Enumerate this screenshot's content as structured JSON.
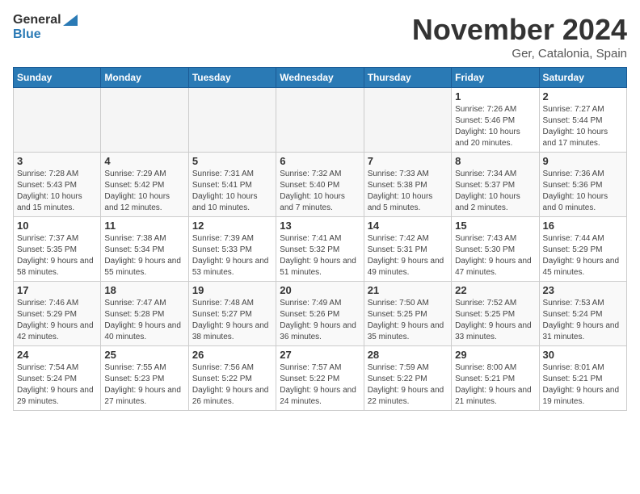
{
  "logo": {
    "line1": "General",
    "line2": "Blue"
  },
  "title": "November 2024",
  "location": "Ger, Catalonia, Spain",
  "days_of_week": [
    "Sunday",
    "Monday",
    "Tuesday",
    "Wednesday",
    "Thursday",
    "Friday",
    "Saturday"
  ],
  "weeks": [
    [
      {
        "day": "",
        "empty": true
      },
      {
        "day": "",
        "empty": true
      },
      {
        "day": "",
        "empty": true
      },
      {
        "day": "",
        "empty": true
      },
      {
        "day": "",
        "empty": true
      },
      {
        "day": "1",
        "sunrise": "7:26 AM",
        "sunset": "5:46 PM",
        "daylight": "10 hours and 20 minutes."
      },
      {
        "day": "2",
        "sunrise": "7:27 AM",
        "sunset": "5:44 PM",
        "daylight": "10 hours and 17 minutes."
      }
    ],
    [
      {
        "day": "3",
        "sunrise": "7:28 AM",
        "sunset": "5:43 PM",
        "daylight": "10 hours and 15 minutes."
      },
      {
        "day": "4",
        "sunrise": "7:29 AM",
        "sunset": "5:42 PM",
        "daylight": "10 hours and 12 minutes."
      },
      {
        "day": "5",
        "sunrise": "7:31 AM",
        "sunset": "5:41 PM",
        "daylight": "10 hours and 10 minutes."
      },
      {
        "day": "6",
        "sunrise": "7:32 AM",
        "sunset": "5:40 PM",
        "daylight": "10 hours and 7 minutes."
      },
      {
        "day": "7",
        "sunrise": "7:33 AM",
        "sunset": "5:38 PM",
        "daylight": "10 hours and 5 minutes."
      },
      {
        "day": "8",
        "sunrise": "7:34 AM",
        "sunset": "5:37 PM",
        "daylight": "10 hours and 2 minutes."
      },
      {
        "day": "9",
        "sunrise": "7:36 AM",
        "sunset": "5:36 PM",
        "daylight": "10 hours and 0 minutes."
      }
    ],
    [
      {
        "day": "10",
        "sunrise": "7:37 AM",
        "sunset": "5:35 PM",
        "daylight": "9 hours and 58 minutes."
      },
      {
        "day": "11",
        "sunrise": "7:38 AM",
        "sunset": "5:34 PM",
        "daylight": "9 hours and 55 minutes."
      },
      {
        "day": "12",
        "sunrise": "7:39 AM",
        "sunset": "5:33 PM",
        "daylight": "9 hours and 53 minutes."
      },
      {
        "day": "13",
        "sunrise": "7:41 AM",
        "sunset": "5:32 PM",
        "daylight": "9 hours and 51 minutes."
      },
      {
        "day": "14",
        "sunrise": "7:42 AM",
        "sunset": "5:31 PM",
        "daylight": "9 hours and 49 minutes."
      },
      {
        "day": "15",
        "sunrise": "7:43 AM",
        "sunset": "5:30 PM",
        "daylight": "9 hours and 47 minutes."
      },
      {
        "day": "16",
        "sunrise": "7:44 AM",
        "sunset": "5:29 PM",
        "daylight": "9 hours and 45 minutes."
      }
    ],
    [
      {
        "day": "17",
        "sunrise": "7:46 AM",
        "sunset": "5:29 PM",
        "daylight": "9 hours and 42 minutes."
      },
      {
        "day": "18",
        "sunrise": "7:47 AM",
        "sunset": "5:28 PM",
        "daylight": "9 hours and 40 minutes."
      },
      {
        "day": "19",
        "sunrise": "7:48 AM",
        "sunset": "5:27 PM",
        "daylight": "9 hours and 38 minutes."
      },
      {
        "day": "20",
        "sunrise": "7:49 AM",
        "sunset": "5:26 PM",
        "daylight": "9 hours and 36 minutes."
      },
      {
        "day": "21",
        "sunrise": "7:50 AM",
        "sunset": "5:25 PM",
        "daylight": "9 hours and 35 minutes."
      },
      {
        "day": "22",
        "sunrise": "7:52 AM",
        "sunset": "5:25 PM",
        "daylight": "9 hours and 33 minutes."
      },
      {
        "day": "23",
        "sunrise": "7:53 AM",
        "sunset": "5:24 PM",
        "daylight": "9 hours and 31 minutes."
      }
    ],
    [
      {
        "day": "24",
        "sunrise": "7:54 AM",
        "sunset": "5:24 PM",
        "daylight": "9 hours and 29 minutes."
      },
      {
        "day": "25",
        "sunrise": "7:55 AM",
        "sunset": "5:23 PM",
        "daylight": "9 hours and 27 minutes."
      },
      {
        "day": "26",
        "sunrise": "7:56 AM",
        "sunset": "5:22 PM",
        "daylight": "9 hours and 26 minutes."
      },
      {
        "day": "27",
        "sunrise": "7:57 AM",
        "sunset": "5:22 PM",
        "daylight": "9 hours and 24 minutes."
      },
      {
        "day": "28",
        "sunrise": "7:59 AM",
        "sunset": "5:22 PM",
        "daylight": "9 hours and 22 minutes."
      },
      {
        "day": "29",
        "sunrise": "8:00 AM",
        "sunset": "5:21 PM",
        "daylight": "9 hours and 21 minutes."
      },
      {
        "day": "30",
        "sunrise": "8:01 AM",
        "sunset": "5:21 PM",
        "daylight": "9 hours and 19 minutes."
      }
    ]
  ]
}
